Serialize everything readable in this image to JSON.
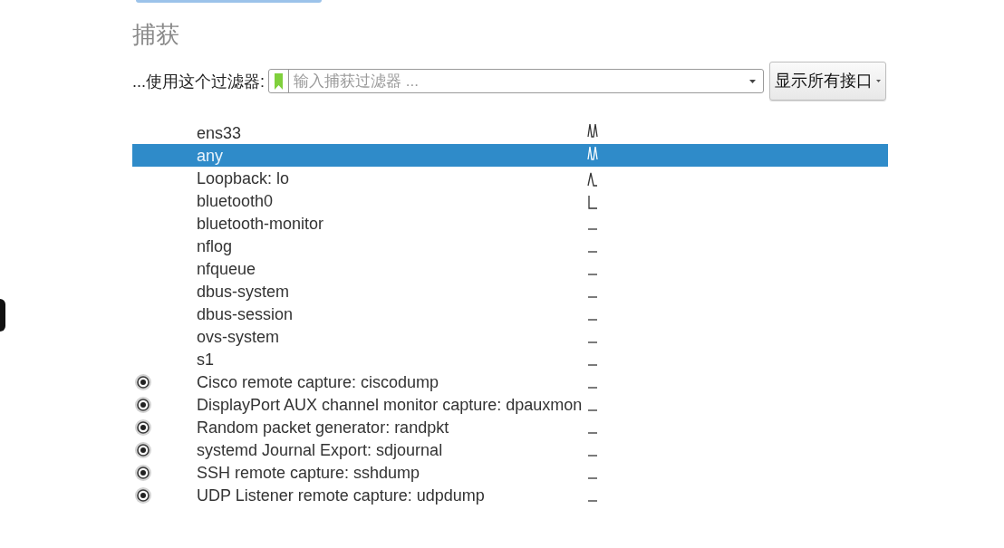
{
  "section": {
    "title": "捕获"
  },
  "filter": {
    "label": "...使用这个过滤器:",
    "placeholder": "输入捕获过滤器 ...",
    "button": "显示所有接口"
  },
  "interfaces": [
    {
      "name": "ens33",
      "kind": "interface",
      "sparkline": {
        "kind": "wave"
      },
      "selected": false
    },
    {
      "name": "any",
      "kind": "interface",
      "sparkline": {
        "kind": "wave"
      },
      "selected": true
    },
    {
      "name": "Loopback: lo",
      "kind": "interface",
      "sparkline": {
        "kind": "spike"
      },
      "selected": false
    },
    {
      "name": "bluetooth0",
      "kind": "interface",
      "sparkline": {
        "kind": "drop"
      },
      "selected": false
    },
    {
      "name": "bluetooth-monitor",
      "kind": "interface",
      "sparkline": {
        "kind": "flat"
      },
      "selected": false
    },
    {
      "name": "nflog",
      "kind": "interface",
      "sparkline": {
        "kind": "flat"
      },
      "selected": false
    },
    {
      "name": "nfqueue",
      "kind": "interface",
      "sparkline": {
        "kind": "flat"
      },
      "selected": false
    },
    {
      "name": "dbus-system",
      "kind": "interface",
      "sparkline": {
        "kind": "flat"
      },
      "selected": false
    },
    {
      "name": "dbus-session",
      "kind": "interface",
      "sparkline": {
        "kind": "flat"
      },
      "selected": false
    },
    {
      "name": "ovs-system",
      "kind": "interface",
      "sparkline": {
        "kind": "flat"
      },
      "selected": false
    },
    {
      "name": "s1",
      "kind": "interface",
      "sparkline": {
        "kind": "flat"
      },
      "selected": false
    },
    {
      "name": "Cisco remote capture: ciscodump",
      "kind": "extcap",
      "sparkline": {
        "kind": "flat"
      },
      "selected": false
    },
    {
      "name": "DisplayPort AUX channel monitor capture: dpauxmon",
      "kind": "extcap",
      "sparkline": {
        "kind": "flat"
      },
      "selected": false
    },
    {
      "name": "Random packet generator: randpkt",
      "kind": "extcap",
      "sparkline": {
        "kind": "flat"
      },
      "selected": false
    },
    {
      "name": "systemd Journal Export: sdjournal",
      "kind": "extcap",
      "sparkline": {
        "kind": "flat"
      },
      "selected": false
    },
    {
      "name": "SSH remote capture: sshdump",
      "kind": "extcap",
      "sparkline": {
        "kind": "flat"
      },
      "selected": false
    },
    {
      "name": "UDP Listener remote capture: udpdump",
      "kind": "extcap",
      "sparkline": {
        "kind": "flat"
      },
      "selected": false
    }
  ]
}
